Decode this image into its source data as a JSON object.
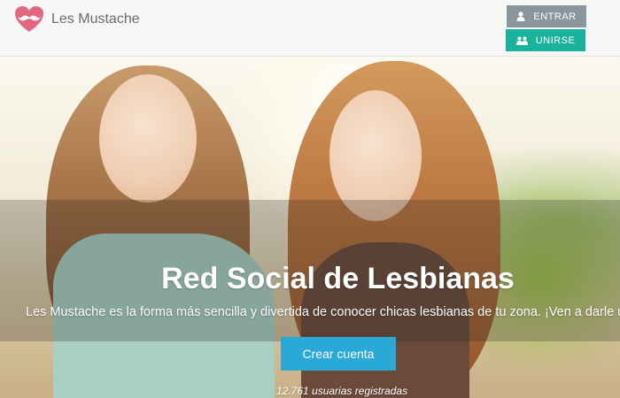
{
  "header": {
    "logo_text": "Les Mustache",
    "login_label": "ENTRAR",
    "join_label": "UNIRSE"
  },
  "hero": {
    "title": "Red Social de Lesbianas",
    "subtitle": "Les Mustache es la forma más sencilla y divertida de conocer chicas lesbianas de tu zona. ¡Ven a darle un vi",
    "cta_label": "Crear cuenta",
    "users_count": "12.761 usuarias registradas"
  },
  "icons": {
    "logo": "heart-mustache-icon",
    "login": "user-icon",
    "join": "users-icon"
  },
  "colors": {
    "logo_pink": "#e2687f",
    "login_button": "#8a959c",
    "join_button": "#18b39a",
    "cta_button": "#2aa8d6"
  }
}
